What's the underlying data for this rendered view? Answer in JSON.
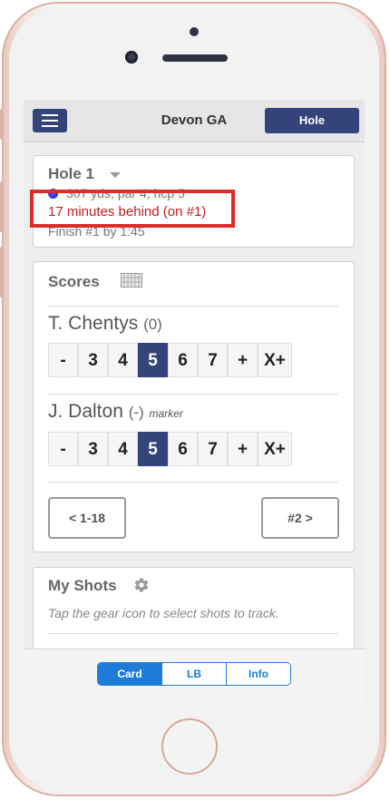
{
  "header": {
    "title": "Devon GA",
    "hole_button": "Hole"
  },
  "hole": {
    "title": "Hole 1",
    "info": "307 yds, par 4, hcp 5",
    "behind": "17 minutes behind (on #1)",
    "finish": "Finish #1 by 1:45"
  },
  "scores": {
    "title": "Scores",
    "players": [
      {
        "name": "T. Chentys",
        "hcp": "(0)",
        "marker": "",
        "buttons": [
          "-",
          "3",
          "4",
          "5",
          "6",
          "7",
          "+",
          "X+"
        ],
        "selected": "5"
      },
      {
        "name": "J. Dalton",
        "hcp": "(-)",
        "marker": "marker",
        "buttons": [
          "-",
          "3",
          "4",
          "5",
          "6",
          "7",
          "+",
          "X+"
        ],
        "selected": "5"
      }
    ],
    "prev_button": "< 1-18",
    "next_button": "#2 >"
  },
  "shots": {
    "title": "My Shots",
    "hint": "Tap the gear icon to select shots to track."
  },
  "tabs": [
    "Card",
    "LB",
    "Info"
  ],
  "colors": {
    "primary": "#34437a",
    "alert": "#c41d1d",
    "tab_accent": "#1e7bd8",
    "highlight_box": "#e02b2b"
  }
}
